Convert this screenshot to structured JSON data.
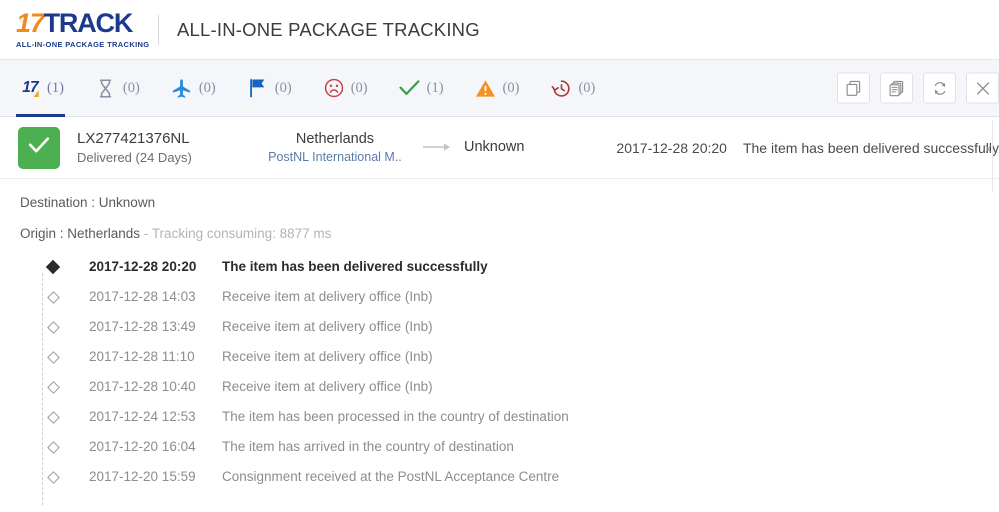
{
  "header": {
    "logo_prefix": "17",
    "logo_suffix": "TRACK",
    "logo_tagline": "ALL-IN-ONE PACKAGE TRACKING",
    "title": "ALL-IN-ONE PACKAGE TRACKING"
  },
  "tabs": [
    {
      "icon": "17track-logo-icon",
      "label": "17",
      "count": "(1)",
      "active": true,
      "color": "#1b3a8c"
    },
    {
      "icon": "hourglass-icon",
      "label": "",
      "count": "(0)",
      "active": false,
      "color": "#8b8fa3"
    },
    {
      "icon": "airplane-icon",
      "label": "",
      "count": "(0)",
      "active": false,
      "color": "#2a8bdc"
    },
    {
      "icon": "flag-icon",
      "label": "",
      "count": "(0)",
      "active": false,
      "color": "#1565c0"
    },
    {
      "icon": "sad-face-icon",
      "label": "",
      "count": "(0)",
      "active": false,
      "color": "#c2414a"
    },
    {
      "icon": "check-icon",
      "label": "",
      "count": "(1)",
      "active": false,
      "color": "#3c9a4e"
    },
    {
      "icon": "warning-triangle-icon",
      "label": "",
      "count": "(0)",
      "active": false,
      "color": "#f59120"
    },
    {
      "icon": "history-clock-icon",
      "label": "",
      "count": "(0)",
      "active": false,
      "color": "#a93a3a"
    }
  ],
  "toolbar": {
    "copy_label": "copy-icon",
    "copy_all_label": "copy-multiple-icon",
    "refresh_label": "refresh-icon",
    "close_label": "close-icon"
  },
  "result": {
    "status_icon": "check-icon",
    "tracking_number": "LX277421376NL",
    "status_text": "Delivered (24 Days)",
    "origin_country": "Netherlands",
    "carrier": "PostNL International M..",
    "destination_country": "Unknown",
    "last_event_date": "2017-12-28 20:20",
    "last_event_desc": "The item has been delivered successfully",
    "close_label": "x"
  },
  "detail": {
    "destination_line": "Destination : Unknown",
    "origin_line": "Origin : Netherlands",
    "origin_sub": " - Tracking consuming: 8877 ms"
  },
  "timeline": [
    {
      "date": "2017-12-28 20:20",
      "desc": "The item has been delivered successfully",
      "current": true
    },
    {
      "date": "2017-12-28 14:03",
      "desc": "Receive item at delivery office (Inb)",
      "current": false
    },
    {
      "date": "2017-12-28 13:49",
      "desc": "Receive item at delivery office (Inb)",
      "current": false
    },
    {
      "date": "2017-12-28 11:10",
      "desc": "Receive item at delivery office (Inb)",
      "current": false
    },
    {
      "date": "2017-12-28 10:40",
      "desc": "Receive item at delivery office (Inb)",
      "current": false
    },
    {
      "date": "2017-12-24 12:53",
      "desc": "The item has been processed in the country of destination",
      "current": false
    },
    {
      "date": "2017-12-20 16:04",
      "desc": "The item has arrived in the country of destination",
      "current": false
    },
    {
      "date": "2017-12-20 15:59",
      "desc": "Consignment received at the PostNL Acceptance Centre",
      "current": false
    }
  ],
  "colors": {
    "brand_blue": "#1b3a8c",
    "brand_orange": "#f08a1e",
    "delivered_green": "#4caf50",
    "tabbar_bg": "#f5f6fa"
  }
}
